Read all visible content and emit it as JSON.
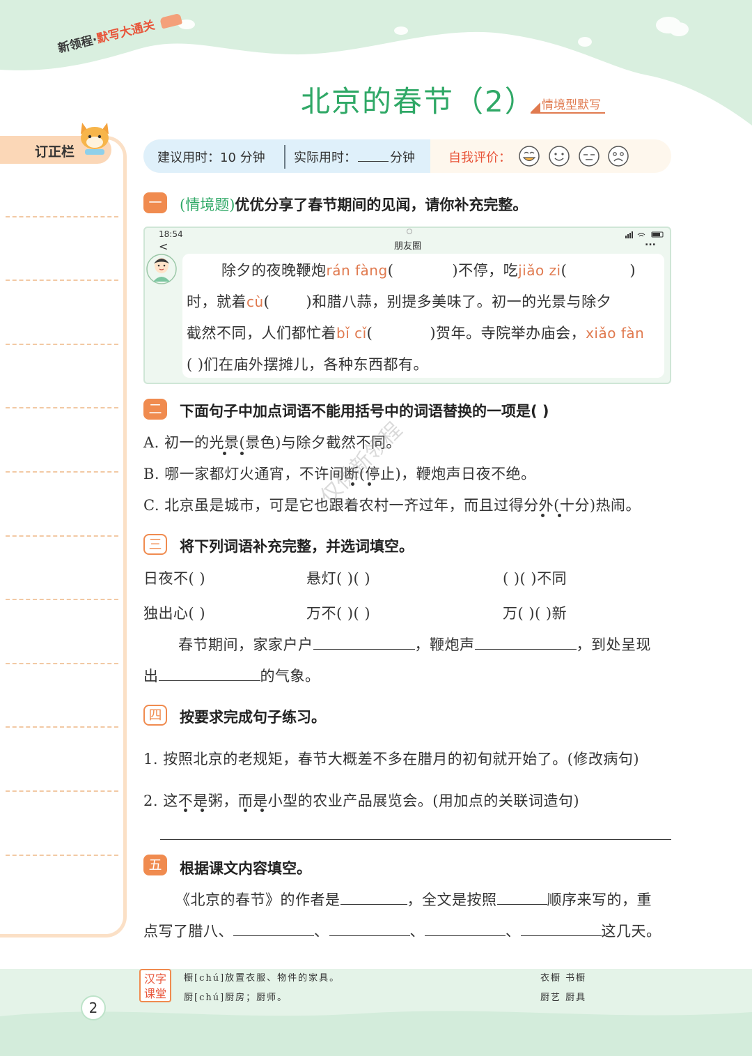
{
  "header": {
    "series_prefix": "新领程·",
    "series_accent": "默写大通关",
    "title": "北京的春节（2）",
    "tag": "情境型默写"
  },
  "correction_label": "订正栏",
  "time_bar": {
    "suggested_label": "建议用时：",
    "suggested_value": "10 分钟",
    "actual_label": "实际用时：",
    "actual_unit": "分钟",
    "eval_label": "自我评价：",
    "faces": [
      "grin-face-icon",
      "smile-face-icon",
      "neutral-face-icon",
      "sad-face-icon"
    ]
  },
  "section1": {
    "badge": "一",
    "tag": "(情境题)",
    "title": "优优分享了春节期间的见闻，请你补充完整。",
    "phone": {
      "time": "18:54",
      "back": "<",
      "header": "朋友圈",
      "more": "..."
    },
    "line1_a": "除夕的夜晚鞭炮",
    "line1_py1": "rán fàng",
    "line1_b": "(",
    "line1_c": ")不停，吃",
    "line1_py2": "jiǎo zi",
    "line1_d": "(",
    "line1_e": ")",
    "line2_a": "时，就着",
    "line2_py": "cù",
    "line2_b": "(",
    "line2_c": ")和腊八蒜，别提多美味了。初一的光景与除夕",
    "line3_a": "截然不同，人们都忙着",
    "line3_py": "bǐ cǐ",
    "line3_b": "(",
    "line3_c": ")贺年。寺院举办庙会，",
    "line3_py2": "xiǎo fàn",
    "line4": "(              )们在庙外摆摊儿，各种东西都有。"
  },
  "section2": {
    "badge": "二",
    "title": "下面句子中加点词语不能用括号中的词语替换的一项是(        )",
    "a": "A. 初一的光景(景色)与除夕截然不同。",
    "b": "B. 哪一家都灯火通宵，不许间断(停止)，鞭炮声日夜不绝。",
    "c": "C. 北京虽是城市，可是它也跟着农村一齐过年，而且过得分外(十分)热闹。"
  },
  "section3": {
    "badge": "三",
    "title": "将下列词语补充完整，并选词填空。",
    "row1": [
      "日夜不(        )",
      "悬灯(        )(        )",
      "(        )(        )不同"
    ],
    "row2": [
      "独出心(        )",
      "万不(        )(        )",
      "万(        )(        )新"
    ],
    "sentence_a": "春节期间，家家户户",
    "sentence_b": "，鞭炮声",
    "sentence_c": "，到处呈现",
    "sentence_d": "出",
    "sentence_e": "的气象。"
  },
  "section4": {
    "badge": "四",
    "title": "按要求完成句子练习。",
    "q1": "1. 按照北京的老规矩，春节大概差不多在腊月的初旬就开始了。(修改病句)",
    "q2": "2. 这不是粥，而是小型的农业产品展览会。(用加点的关联词造句)"
  },
  "section5": {
    "badge": "五",
    "title": "根据课文内容填空。",
    "line1_a": "《北京的春节》的作者是",
    "line1_b": "，全文是按照",
    "line1_c": "顺序来写的，重",
    "line2_a": "点写了腊八、",
    "sep": "、",
    "line2_end": "这几天。"
  },
  "footer": {
    "badge_line1": "汉字",
    "badge_line2": "课堂",
    "entry1": "橱[chú]放置衣服、物件的家具。",
    "entry2": "厨[chú]厨房；厨师。",
    "words1": "衣橱   书橱",
    "words2": "厨艺   厨具",
    "page": "2"
  },
  "watermark": "仅供新领程",
  "colors": {
    "accent_green": "#2fa866",
    "accent_orange": "#f08b4f",
    "header_mint": "#d9efdf",
    "time_blue": "#dff0fa",
    "correction_orange": "#fbd7b7"
  }
}
